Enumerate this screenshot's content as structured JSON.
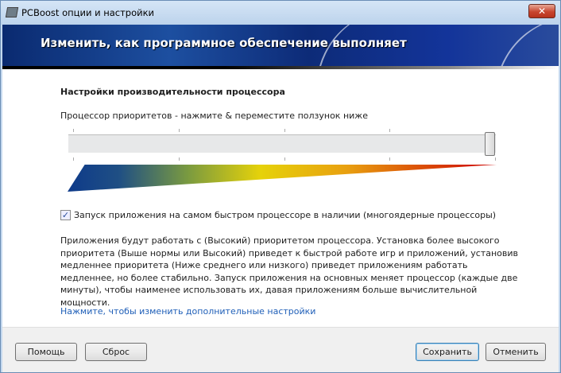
{
  "window": {
    "title": "PCBoost опции и настройки",
    "close": "✕"
  },
  "banner": {
    "title": "Изменить, как программное обеспечение выполняет"
  },
  "section": {
    "heading": "Настройки производительности процессора",
    "slider_label": "Процессор приоритетов - нажмите & переместите ползунок ниже",
    "slider_value_percent": 100
  },
  "checkbox": {
    "label": "Запуск приложения на самом быстром процессоре в наличии (многоядерные процессоры)",
    "checked": true,
    "mark": "✓"
  },
  "description": "Приложения будут работать с (Высокий) приоритетом процессора. Установка более высокого приоритета (Выше нормы или Высокий) приведет к быстрой работе игр и приложений, установив медленнее приоритета (Ниже среднего или низкого) приведет приложениям работать медленнее, но более стабильно. Запуск приложения на основных меняет процессор (каждые две минуты), чтобы наименее использовать их, давая приложениям больше вычислительной мощности.",
  "link": "Нажмите, чтобы изменить дополнительные настройки",
  "buttons": {
    "help": "Помощь",
    "reset": "Сброс",
    "save": "Сохранить",
    "cancel": "Отменить"
  }
}
